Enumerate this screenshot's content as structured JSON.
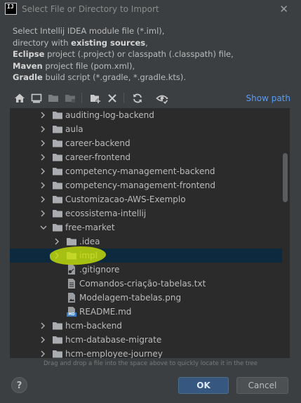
{
  "dialog": {
    "title": "Select File or Directory to Import",
    "app_icon_text": "IJ"
  },
  "description": [
    [
      {
        "text": "Select Intellij IDEA module file (*.iml),",
        "bold": false
      }
    ],
    [
      {
        "text": "directory with ",
        "bold": false
      },
      {
        "text": "existing sources",
        "bold": true
      },
      {
        "text": ",",
        "bold": false
      }
    ],
    [
      {
        "text": "Eclipse",
        "bold": true
      },
      {
        "text": " project (.project) or classpath (.classpath) file,",
        "bold": false
      }
    ],
    [
      {
        "text": "Maven",
        "bold": true
      },
      {
        "text": " project file (pom.xml),",
        "bold": false
      }
    ],
    [
      {
        "text": "Gradle",
        "bold": true
      },
      {
        "text": " build script (*.gradle, *.gradle.kts).",
        "bold": false
      }
    ]
  ],
  "toolbar": {
    "show_path_label": "Show path"
  },
  "tree": {
    "rows": [
      {
        "label": "auditing-log-backend",
        "type": "folder",
        "level": 0,
        "state": "collapsed"
      },
      {
        "label": "aula",
        "type": "folder",
        "level": 0,
        "state": "collapsed"
      },
      {
        "label": "career-backend",
        "type": "folder",
        "level": 0,
        "state": "collapsed"
      },
      {
        "label": "career-frontend",
        "type": "folder",
        "level": 0,
        "state": "collapsed"
      },
      {
        "label": "competency-management-backend",
        "type": "folder",
        "level": 0,
        "state": "collapsed"
      },
      {
        "label": "competency-management-frontend",
        "type": "folder",
        "level": 0,
        "state": "collapsed"
      },
      {
        "label": "Customizacao-AWS-Exemplo",
        "type": "folder",
        "level": 0,
        "state": "collapsed"
      },
      {
        "label": "ecossistema-intellij",
        "type": "folder",
        "level": 0,
        "state": "collapsed"
      },
      {
        "label": "free-market",
        "type": "folder",
        "level": 0,
        "state": "expanded"
      },
      {
        "label": ".idea",
        "type": "folder",
        "level": 1,
        "state": "collapsed"
      },
      {
        "label": "impl",
        "type": "folder",
        "level": 1,
        "state": "collapsed",
        "selected": true
      },
      {
        "label": ".gitignore",
        "type": "gitignore",
        "level": 1,
        "state": "leaf"
      },
      {
        "label": "Comandos-criação-tabelas.txt",
        "type": "text-file",
        "level": 1,
        "state": "leaf"
      },
      {
        "label": "Modelagem-tabelas.png",
        "type": "image-file",
        "level": 1,
        "state": "leaf"
      },
      {
        "label": "README.md",
        "type": "markdown-file",
        "level": 1,
        "state": "leaf",
        "badge": "MD"
      },
      {
        "label": "hcm-backend",
        "type": "folder",
        "level": 0,
        "state": "collapsed"
      },
      {
        "label": "hcm-database-migrate",
        "type": "folder",
        "level": 0,
        "state": "collapsed"
      },
      {
        "label": "hcm-employee-journey",
        "type": "folder",
        "level": 0,
        "state": "collapsed"
      }
    ]
  },
  "hint": "Drag and drop a file into the space above to quickly locate it in the tree",
  "footer": {
    "help_label": "?",
    "ok_label": "OK",
    "cancel_label": "Cancel"
  },
  "colors": {
    "background": "#3c3f41",
    "tree_background": "#2b2b2b",
    "selection": "#0d293e",
    "folder": "#a9adb1",
    "link": "#589df6",
    "ok_button": "#365880",
    "highlight_mark": "#c8e00a"
  }
}
